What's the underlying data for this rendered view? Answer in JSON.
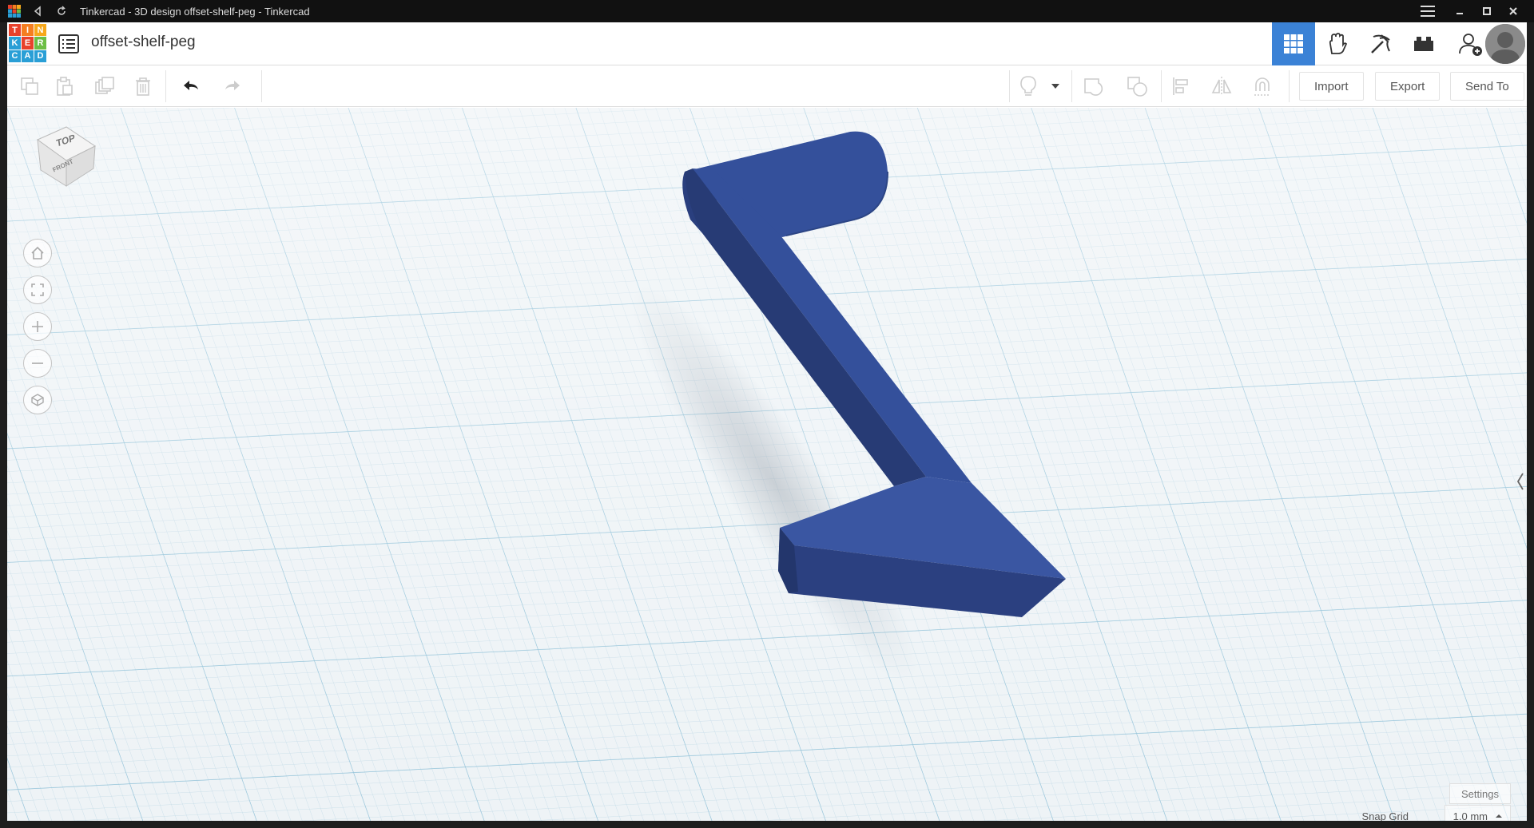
{
  "window": {
    "title": "Tinkercad - 3D design offset-shelf-peg - Tinkercad"
  },
  "header": {
    "logo_letters": [
      "T",
      "I",
      "N",
      "K",
      "E",
      "R",
      "C",
      "A",
      "D"
    ],
    "logo_colors": [
      "#e8412b",
      "#f57e20",
      "#f7a81b",
      "#2a9fd6",
      "#e8412b",
      "#6cbe45",
      "#2a9fd6",
      "#2a9fd6",
      "#2a9fd6"
    ],
    "design_name": "offset-shelf-peg",
    "accent": "#3b82d6"
  },
  "toolbar": {
    "import_label": "Import",
    "export_label": "Export",
    "send_to_label": "Send To"
  },
  "viewcube": {
    "top_label": "TOP",
    "front_label": "FRONT"
  },
  "footer": {
    "settings_label": "Settings",
    "snap_grid_label": "Snap Grid",
    "snap_grid_value": "1.0 mm"
  },
  "model": {
    "color": "#34509b"
  }
}
